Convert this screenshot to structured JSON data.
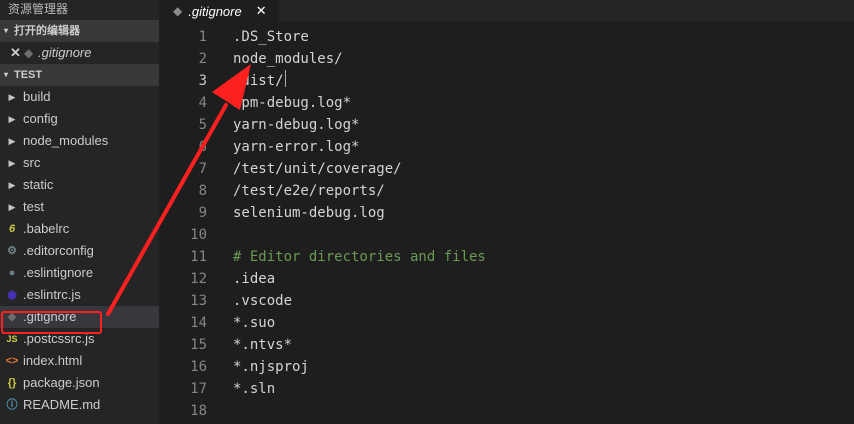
{
  "sidebar": {
    "title": "资源管理器",
    "open_editors": {
      "label": "打开的编辑器",
      "items": [
        {
          "label": ".gitignore"
        }
      ]
    },
    "project": {
      "label": "TEST"
    },
    "folders": [
      {
        "label": "build"
      },
      {
        "label": "config"
      },
      {
        "label": "node_modules"
      },
      {
        "label": "src"
      },
      {
        "label": "static"
      },
      {
        "label": "test"
      }
    ],
    "files": [
      {
        "label": ".babelrc",
        "icon": "babel-icon",
        "glyph": "6"
      },
      {
        "label": ".editorconfig",
        "icon": "gear-icon",
        "glyph": "⚙"
      },
      {
        "label": ".eslintignore",
        "icon": "eslint-ignore-icon",
        "glyph": "●"
      },
      {
        "label": ".eslintrc.js",
        "icon": "eslint-icon",
        "glyph": "◉"
      },
      {
        "label": ".gitignore",
        "icon": "git-icon",
        "glyph": "◆"
      },
      {
        "label": ".postcssrc.js",
        "icon": "js-icon",
        "glyph": "JS"
      },
      {
        "label": "index.html",
        "icon": "html-icon",
        "glyph": "<>"
      },
      {
        "label": "package.json",
        "icon": "json-icon",
        "glyph": "{}"
      },
      {
        "label": "README.md",
        "icon": "info-icon",
        "glyph": "ⓘ"
      }
    ]
  },
  "tab": {
    "label": ".gitignore",
    "close": "✕"
  },
  "editor": {
    "current_line": 3,
    "lines": [
      {
        "n": "1",
        "text": ".DS_Store"
      },
      {
        "n": "2",
        "text": "node_modules/"
      },
      {
        "n": "3",
        "text": "/dist/"
      },
      {
        "n": "4",
        "text": "npm-debug.log*"
      },
      {
        "n": "5",
        "text": "yarn-debug.log*"
      },
      {
        "n": "6",
        "text": "yarn-error.log*"
      },
      {
        "n": "7",
        "text": "/test/unit/coverage/"
      },
      {
        "n": "8",
        "text": "/test/e2e/reports/"
      },
      {
        "n": "9",
        "text": "selenium-debug.log"
      },
      {
        "n": "10",
        "text": ""
      },
      {
        "n": "11",
        "text": "# Editor directories and files",
        "comment": true
      },
      {
        "n": "12",
        "text": ".idea"
      },
      {
        "n": "13",
        "text": ".vscode"
      },
      {
        "n": "14",
        "text": "*.suo"
      },
      {
        "n": "15",
        "text": "*.ntvs*"
      },
      {
        "n": "16",
        "text": "*.njsproj"
      },
      {
        "n": "17",
        "text": "*.sln"
      },
      {
        "n": "18",
        "text": ""
      }
    ]
  },
  "annotation": {
    "color": "#ff2020"
  }
}
